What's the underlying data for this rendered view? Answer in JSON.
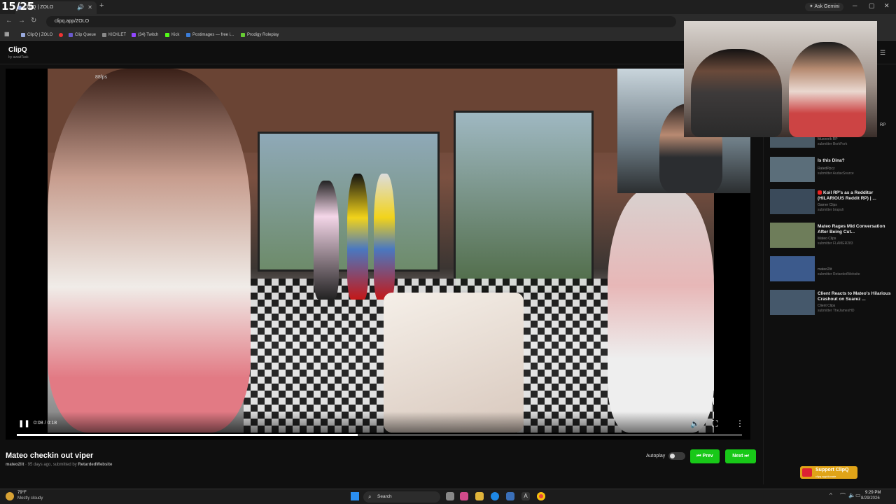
{
  "overlay_count": "15/25",
  "browser": {
    "tab_title": "ClipQ | ZOLO",
    "tab_audio_icon": "speaker-icon",
    "new_tab": "+",
    "ask_gemini": "Ask Gemini",
    "url": "clipq.app/ZOLO",
    "bookmarks": [
      {
        "label": "ClipQ | ZOLO",
        "color": "#9ad"
      },
      {
        "label": "",
        "color": "#e33"
      },
      {
        "label": "Clip Queue",
        "color": "#6a5acd"
      },
      {
        "label": "KICKLET",
        "color": "#888"
      },
      {
        "label": "(34) Twitch",
        "color": "#9146ff"
      },
      {
        "label": "Kick",
        "color": "#53fc18"
      },
      {
        "label": "Postimages — free i...",
        "color": "#3b7dd8"
      },
      {
        "label": "Prodigy Roleplay",
        "color": "#6c3"
      }
    ]
  },
  "app": {
    "logo": "ClipQ",
    "logo_by": "by awaitTask"
  },
  "player": {
    "fps": "88fps",
    "time": "0:08 / 0:18",
    "progress": 0.47,
    "play_icon": "pause-icon"
  },
  "clip": {
    "title": "Mateo checkin out viper",
    "channel": "mateo2lit",
    "meta_mid": " · 95 days ago, submitted by ",
    "submitter": "RetardedWebsite"
  },
  "autoplay": {
    "label": "Autoplay",
    "on": false
  },
  "nav": {
    "prev": "⏮ Prev",
    "next": "Next ⏭"
  },
  "sidebar": {
    "items": [
      {
        "title": "",
        "channel": "Muxenrik RP",
        "submitter": "submitter BorkFork",
        "thumb": "#4a5a66"
      },
      {
        "title": "Is this Dina?",
        "channel": "RatedPpcz",
        "submitter": "submitter AudaxSource",
        "thumb": "#5b6e7a"
      },
      {
        "title": "Koil RP's as a Redditor (HILARIOUS Reddit RP) | ...",
        "channel": "Gamer Clips",
        "submitter": "submitter brapuli",
        "thumb": "#3a4a5a"
      },
      {
        "title": "Mateo Rages Mid Conversation After Being Cut...",
        "channel": "Mateo Clips",
        "submitter": "submitter FLAMER283",
        "thumb": "#6e7d5a"
      },
      {
        "title": "",
        "channel": "mateo2lit",
        "submitter": "submitter RetardedWebsite",
        "thumb": "#3c5a8c"
      },
      {
        "title": "Client Reacts to Mateo's Hilarious Crashout on Suarez ...",
        "channel": "Client Clips",
        "submitter": "submitter TheJamesHD",
        "thumb": "#45586b"
      }
    ],
    "support_label": "Support ClipQ",
    "support_sub": "clipq.app/donate",
    "rp_badge": "RP"
  },
  "taskbar": {
    "temp": "79°F",
    "weather": "Mostly cloudy",
    "search": "Search",
    "time": "9:29 PM",
    "date": "8/29/2026"
  }
}
